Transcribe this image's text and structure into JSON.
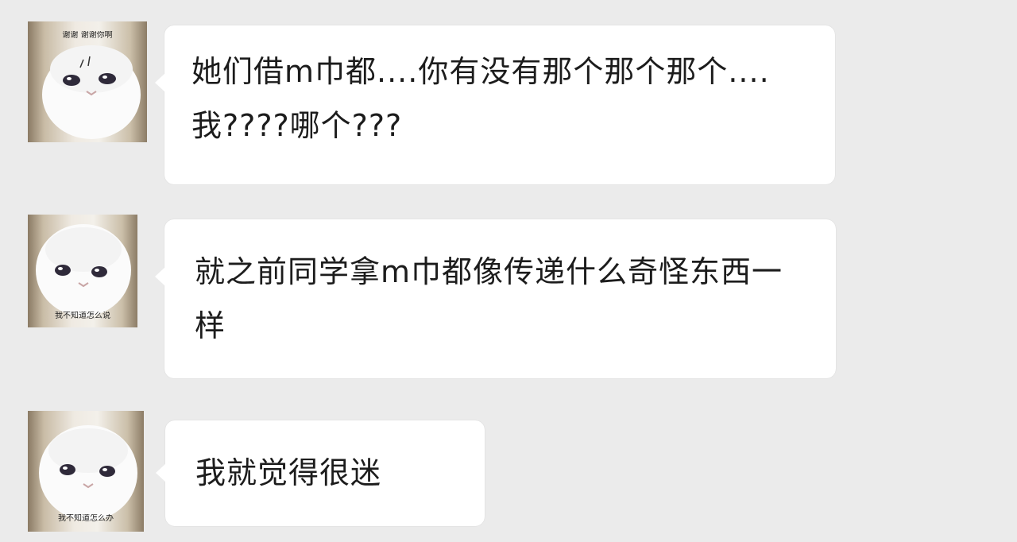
{
  "conversation": {
    "messages": [
      {
        "sender": "other",
        "avatar_caption": "谢谢 谢谢你啊",
        "text": "她们借m巾都....你有没有那个那个那个....我????哪个???"
      },
      {
        "sender": "other",
        "avatar_caption": "我不知道怎么说",
        "text": "就之前同学拿m巾都像传递什么奇怪东西一样"
      },
      {
        "sender": "other",
        "avatar_caption": "我不知道怎么办",
        "text": "我就觉得很迷"
      }
    ]
  },
  "colors": {
    "background": "#ebebeb",
    "bubble": "#ffffff",
    "text": "#1c1c1c"
  }
}
